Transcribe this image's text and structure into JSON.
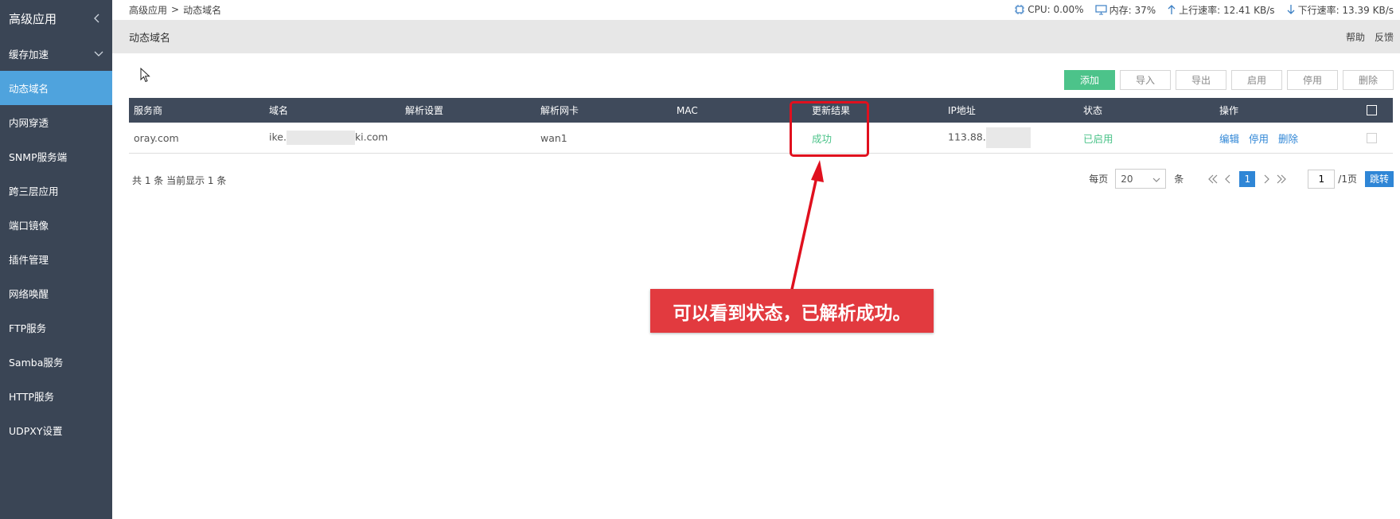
{
  "sidebar": {
    "title": "高级应用",
    "items": [
      {
        "label": "缓存加速",
        "has_chevron": true
      },
      {
        "label": "动态域名",
        "active": true
      },
      {
        "label": "内网穿透"
      },
      {
        "label": "SNMP服务端"
      },
      {
        "label": "跨三层应用"
      },
      {
        "label": "端口镜像"
      },
      {
        "label": "插件管理"
      },
      {
        "label": "网络唤醒"
      },
      {
        "label": "FTP服务"
      },
      {
        "label": "Samba服务"
      },
      {
        "label": "HTTP服务"
      },
      {
        "label": "UDPXY设置"
      }
    ]
  },
  "breadcrumb": {
    "root": "高级应用",
    "separator": ">",
    "current": "动态域名"
  },
  "stats": {
    "cpu": "CPU: 0.00%",
    "memory": "内存: 37%",
    "upload": "上行速率: 12.41 KB/s",
    "download": "下行速率: 13.39 KB/s"
  },
  "page": {
    "title": "动态域名",
    "help": "帮助",
    "feedback": "反馈"
  },
  "toolbar": {
    "add": "添加",
    "import": "导入",
    "export": "导出",
    "enable": "启用",
    "disable": "停用",
    "delete": "删除"
  },
  "table": {
    "headers": [
      "服务商",
      "域名",
      "解析设置",
      "解析网卡",
      "MAC",
      "更新结果",
      "IP地址",
      "状态",
      "操作"
    ],
    "rows": [
      {
        "provider": "oray.com",
        "domain_prefix": "ike.",
        "domain_suffix": "ki.com",
        "resolve": "",
        "nic": "wan1",
        "mac": "",
        "result": "成功",
        "ip": "113.88.",
        "status": "已启用",
        "actions": {
          "edit": "编辑",
          "disable": "停用",
          "delete": "删除"
        }
      }
    ]
  },
  "summary": "共 1 条 当前显示 1 条",
  "pagination": {
    "per_page_label": "每页",
    "per_page": "20",
    "unit": "条",
    "current_page": "1",
    "page_input": "1",
    "total": "/1页",
    "jump": "跳转"
  },
  "annotation": {
    "text": "可以看到状态，已解析成功。"
  },
  "colors": {
    "sidebar": "#3a4555",
    "active": "#4fa3dd",
    "table_header": "#3f4a5b",
    "success": "#4cc38a",
    "link": "#2f86d6",
    "annotation": "#e23a3f"
  }
}
